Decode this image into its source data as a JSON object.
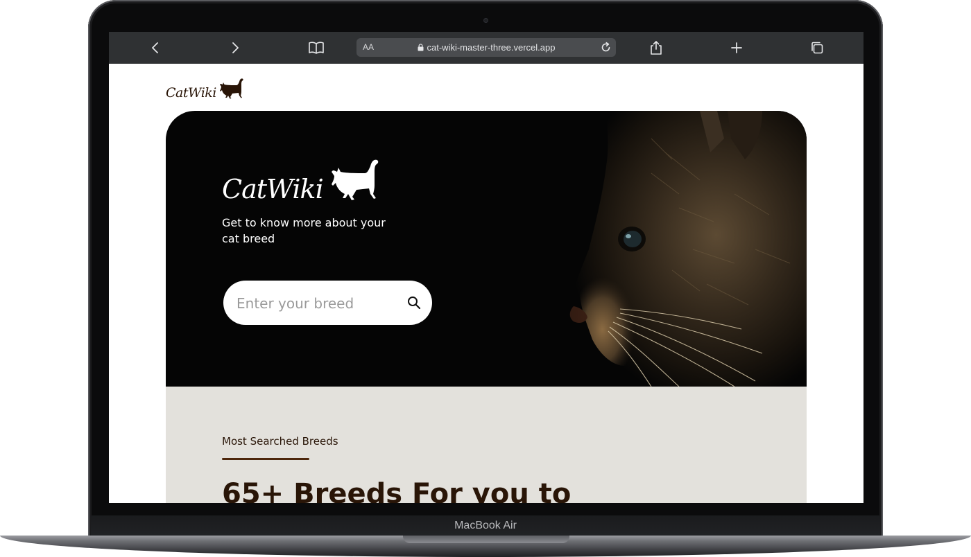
{
  "device": {
    "label": "MacBook Air"
  },
  "browser": {
    "text_size_label": "AA",
    "url": "cat-wiki-master-three.vercel.app",
    "icons": [
      "back-icon",
      "forward-icon",
      "bookmarks-icon",
      "lock-icon",
      "reload-icon",
      "share-icon",
      "new-tab-icon",
      "tabs-icon"
    ]
  },
  "site": {
    "logo_text": "CatWiki",
    "hero": {
      "logo_text": "CatWiki",
      "tagline": "Get to know more about your cat breed",
      "search_placeholder": "Enter your breed"
    },
    "breeds": {
      "section_label": "Most Searched Breeds",
      "headline": "65+ Breeds For you to"
    },
    "colors": {
      "brand_dark": "#291507",
      "accent_underline": "#4d270c",
      "hero_background": "#050505",
      "section_background": "#e3e1dc"
    }
  }
}
